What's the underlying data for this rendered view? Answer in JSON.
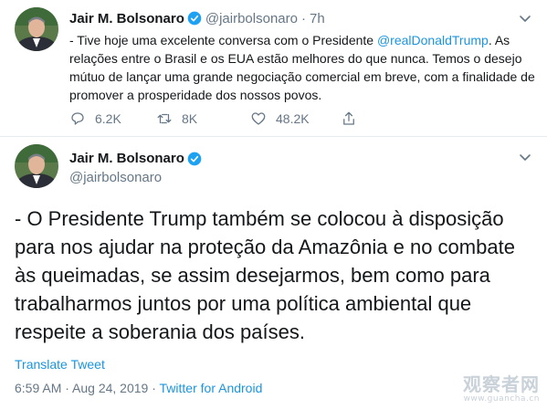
{
  "tweet_top": {
    "name": "Jair M. Bolsonaro",
    "handle": "@jairbolsonaro",
    "separator": "·",
    "time": "7h",
    "text_before": "- Tive hoje uma excelente conversa com o Presidente ",
    "mention": "@realDonaldTrump",
    "text_after": ". As relações entre o Brasil e os EUA estão melhores do que nunca. Temos o desejo mútuo de lançar uma grande negociação comercial em breve, com a finalidade de promover a prosperidade dos nossos povos.",
    "replies": "6.2K",
    "retweets": "8K",
    "likes": "48.2K"
  },
  "tweet_main": {
    "name": "Jair M. Bolsonaro",
    "handle": "@jairbolsonaro",
    "text": "- O Presidente Trump também se colocou à disposição para nos ajudar na proteção da Amazônia e no combate às queimadas, se assim desejarmos, bem como para trabalharmos juntos por uma política ambiental que respeite a soberania dos países.",
    "translate_label": "Translate Tweet",
    "timestamp": "6:59 AM · Aug 24, 2019 · ",
    "client": "Twitter for Android"
  },
  "icons": {
    "verified": "verified-badge-icon",
    "chevron": "chevron-down-icon",
    "reply": "reply-icon",
    "retweet": "retweet-icon",
    "like": "heart-icon",
    "share": "share-icon"
  },
  "colors": {
    "link": "#1b95e0",
    "muted": "#657786",
    "text": "#14171a",
    "verified": "#1da1f2"
  },
  "watermark": {
    "main": "观察者网",
    "url": "www.guancha.cn"
  }
}
